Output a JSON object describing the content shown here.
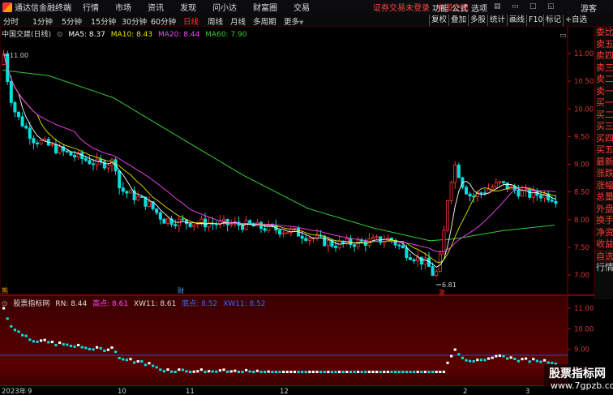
{
  "menubar": {
    "app_title": "通达信金融终端",
    "items": [
      "行情",
      "市场",
      "资讯",
      "发现",
      "问小达",
      "财富圈",
      "交易"
    ],
    "status_login": "证券交易未登录",
    "status_stock": "中国交建",
    "right_items": [
      "功能",
      "公式",
      "选项"
    ],
    "guest": "游客"
  },
  "toolbar": {
    "periods": [
      "分时",
      "1分钟",
      "5分钟",
      "15分钟",
      "30分钟",
      "60分钟",
      "日线",
      "周线",
      "月线",
      "多周期",
      "更多"
    ],
    "active_period": "日线",
    "tools": [
      "复权",
      "叠加",
      "多股",
      "统计",
      "画线",
      "F10",
      "标记",
      "+自选"
    ]
  },
  "main_info": {
    "stock": "中国交建(日线)",
    "ma5": "MA5: 8.37",
    "ma10": "MA10: 8.43",
    "ma20": "MA20: 8.44",
    "ma60": "MA60: 7.90"
  },
  "sub_info": {
    "name": "股票指标网",
    "rn": "RN: 8.44",
    "high": "高点: 8.61",
    "xw11": "XW11: 8.61",
    "low": "底点: 8.52",
    "xw11b": "XW11: 8.52"
  },
  "price_axis": [
    "11.00",
    "10.50",
    "10.00",
    "9.50",
    "9.00",
    "8.50",
    "8.00",
    "7.50",
    "7.00"
  ],
  "sub_axis": [
    "11.00",
    "10.00",
    "9.00",
    "8.00"
  ],
  "date_axis": [
    "2023年",
    "9",
    "10",
    "11",
    "12",
    "2",
    "3"
  ],
  "markers": {
    "max_label": "11.00",
    "min_label": "6.81",
    "fin_left": "熊",
    "fin_mid": "财",
    "up_mark": "涨"
  },
  "side_panel": [
    "委比",
    "卖五",
    "卖四",
    "卖三",
    "卖二",
    "卖一",
    "买一",
    "买二",
    "买三",
    "买四",
    "买五",
    "最新",
    "涨跌",
    "涨幅",
    "总量",
    "外盘",
    "换手",
    "净资",
    "收益",
    "自选",
    "行情"
  ],
  "watermark": {
    "title": "股票指标网",
    "url": "www.7gpzb.com"
  },
  "colors": {
    "up": "#ff3333",
    "down": "#00e0e0",
    "ma5": "#ffffff",
    "ma10": "#e8e000",
    "ma20": "#ff44ff",
    "ma60": "#33cc33",
    "accent": "#ff3030"
  }
}
